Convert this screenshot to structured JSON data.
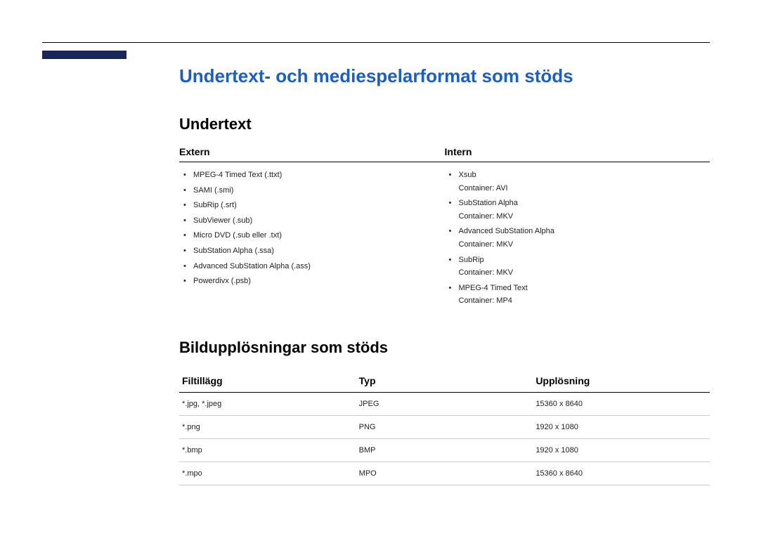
{
  "main_title": "Undertext- och mediespelarformat som stöds",
  "subtitle_section": {
    "heading": "Undertext",
    "col_extern_label": "Extern",
    "col_intern_label": "Intern",
    "extern_items": [
      "MPEG-4 Timed Text (.ttxt)",
      "SAMI (.smi)",
      "SubRip (.srt)",
      "SubViewer (.sub)",
      "Micro DVD (.sub eller .txt)",
      "SubStation Alpha (.ssa)",
      "Advanced SubStation Alpha (.ass)",
      "Powerdivx (.psb)"
    ],
    "intern_items": [
      {
        "name": "Xsub",
        "container": "Container: AVI"
      },
      {
        "name": "SubStation Alpha",
        "container": "Container: MKV"
      },
      {
        "name": "Advanced SubStation Alpha",
        "container": "Container: MKV"
      },
      {
        "name": "SubRip",
        "container": "Container: MKV"
      },
      {
        "name": "MPEG-4 Timed Text",
        "container": "Container: MP4"
      }
    ]
  },
  "image_section": {
    "heading": "Bildupplösningar som stöds",
    "headers": {
      "ext": "Filtillägg",
      "type": "Typ",
      "res": "Upplösning"
    },
    "rows": [
      {
        "ext": "*.jpg, *.jpeg",
        "type": "JPEG",
        "res": "15360 x 8640"
      },
      {
        "ext": "*.png",
        "type": "PNG",
        "res": "1920 x 1080"
      },
      {
        "ext": "*.bmp",
        "type": "BMP",
        "res": "1920 x 1080"
      },
      {
        "ext": "*.mpo",
        "type": "MPO",
        "res": "15360 x 8640"
      }
    ]
  }
}
